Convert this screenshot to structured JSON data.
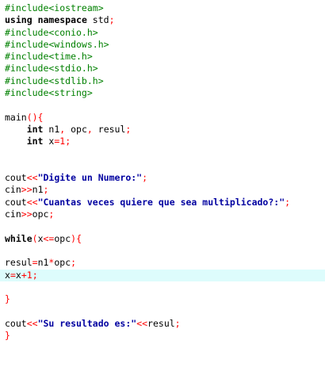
{
  "editor": {
    "highlight_color": "#ddfcfc",
    "colors": {
      "preprocessor": "#008000",
      "keyword": "#000000",
      "operator": "#ff0000",
      "string": "#0000a0"
    },
    "lines": [
      [
        {
          "t": "#include<iostream>",
          "c": "pp"
        }
      ],
      [
        {
          "t": "using",
          "c": "kw"
        },
        {
          "t": " ",
          "c": "id"
        },
        {
          "t": "namespace",
          "c": "kw"
        },
        {
          "t": " std",
          "c": "id"
        },
        {
          "t": ";",
          "c": "op"
        }
      ],
      [
        {
          "t": "#include<conio.h>",
          "c": "pp"
        }
      ],
      [
        {
          "t": "#include<windows.h>",
          "c": "pp"
        }
      ],
      [
        {
          "t": "#include<time.h>",
          "c": "pp"
        }
      ],
      [
        {
          "t": "#include<stdio.h>",
          "c": "pp"
        }
      ],
      [
        {
          "t": "#include<stdlib.h>",
          "c": "pp"
        }
      ],
      [
        {
          "t": "#include<string>",
          "c": "pp"
        }
      ],
      [],
      [
        {
          "t": "main",
          "c": "id"
        },
        {
          "t": "(){",
          "c": "op"
        }
      ],
      [
        {
          "t": "    ",
          "c": "id"
        },
        {
          "t": "int",
          "c": "kw"
        },
        {
          "t": " n1",
          "c": "id"
        },
        {
          "t": ",",
          "c": "op"
        },
        {
          "t": " opc",
          "c": "id"
        },
        {
          "t": ",",
          "c": "op"
        },
        {
          "t": " resul",
          "c": "id"
        },
        {
          "t": ";",
          "c": "op"
        }
      ],
      [
        {
          "t": "    ",
          "c": "id"
        },
        {
          "t": "int",
          "c": "kw"
        },
        {
          "t": " x",
          "c": "id"
        },
        {
          "t": "=",
          "c": "op"
        },
        {
          "t": "1",
          "c": "num"
        },
        {
          "t": ";",
          "c": "op"
        }
      ],
      [],
      [],
      [
        {
          "t": "cout",
          "c": "id"
        },
        {
          "t": "<<",
          "c": "op"
        },
        {
          "t": "\"Digite un Numero:\"",
          "c": "str"
        },
        {
          "t": ";",
          "c": "op"
        }
      ],
      [
        {
          "t": "cin",
          "c": "id"
        },
        {
          "t": ">>",
          "c": "op"
        },
        {
          "t": "n1",
          "c": "id"
        },
        {
          "t": ";",
          "c": "op"
        }
      ],
      [
        {
          "t": "cout",
          "c": "id"
        },
        {
          "t": "<<",
          "c": "op"
        },
        {
          "t": "\"Cuantas veces quiere que sea multiplicado?:\"",
          "c": "str"
        },
        {
          "t": ";",
          "c": "op"
        }
      ],
      [
        {
          "t": "cin",
          "c": "id"
        },
        {
          "t": ">>",
          "c": "op"
        },
        {
          "t": "opc",
          "c": "id"
        },
        {
          "t": ";",
          "c": "op"
        }
      ],
      [],
      [
        {
          "t": "while",
          "c": "kw"
        },
        {
          "t": "(",
          "c": "op"
        },
        {
          "t": "x",
          "c": "id"
        },
        {
          "t": "<=",
          "c": "op"
        },
        {
          "t": "opc",
          "c": "id"
        },
        {
          "t": "){",
          "c": "op"
        }
      ],
      [],
      [
        {
          "t": "resul",
          "c": "id"
        },
        {
          "t": "=",
          "c": "op"
        },
        {
          "t": "n1",
          "c": "id"
        },
        {
          "t": "*",
          "c": "op"
        },
        {
          "t": "opc",
          "c": "id"
        },
        {
          "t": ";",
          "c": "op"
        }
      ],
      [
        {
          "t": "x",
          "c": "id"
        },
        {
          "t": "=",
          "c": "op"
        },
        {
          "t": "x",
          "c": "id"
        },
        {
          "t": "+",
          "c": "op"
        },
        {
          "t": "1",
          "c": "num"
        },
        {
          "t": ";",
          "c": "op"
        }
      ],
      [],
      [
        {
          "t": "}",
          "c": "op"
        }
      ],
      [],
      [
        {
          "t": "cout",
          "c": "id"
        },
        {
          "t": "<<",
          "c": "op"
        },
        {
          "t": "\"Su resultado es:\"",
          "c": "str"
        },
        {
          "t": "<<",
          "c": "op"
        },
        {
          "t": "resul",
          "c": "id"
        },
        {
          "t": ";",
          "c": "op"
        }
      ],
      [
        {
          "t": "}",
          "c": "op"
        }
      ]
    ],
    "highlighted_line": 22
  }
}
